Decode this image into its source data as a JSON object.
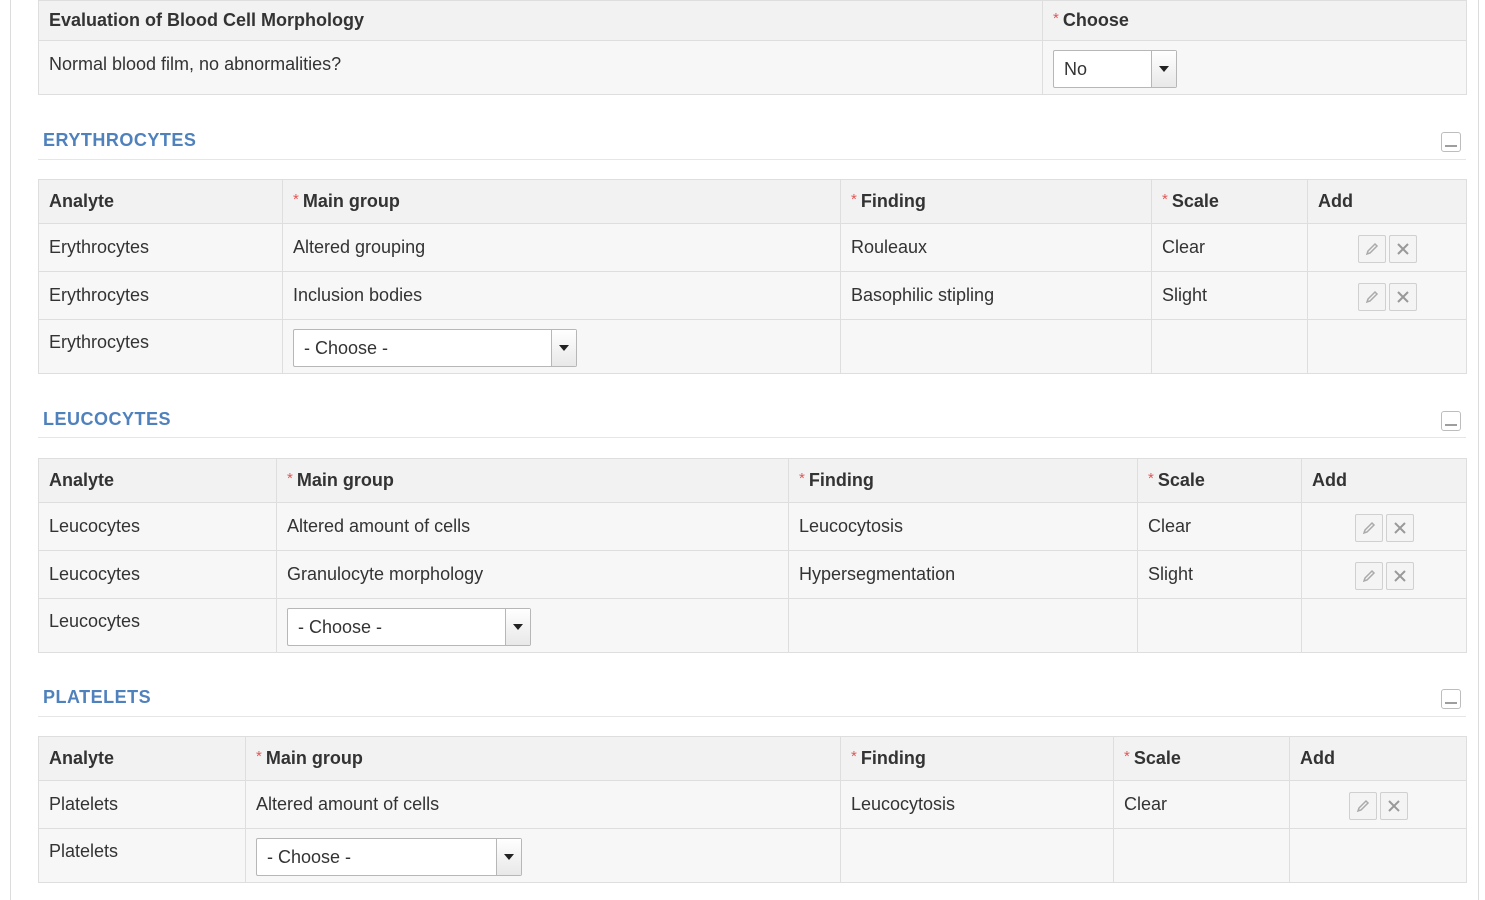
{
  "evaluation": {
    "headers": {
      "title": "Evaluation of Blood Cell Morphology",
      "choose": "Choose"
    },
    "question": "Normal blood film, no abnormalities?",
    "selected": "No"
  },
  "sections": {
    "erythrocytes": {
      "title": "ERYTHROCYTES",
      "headers": {
        "analyte": "Analyte",
        "main_group": "Main group",
        "finding": "Finding",
        "scale": "Scale",
        "add": "Add"
      },
      "rows": [
        {
          "analyte": "Erythrocytes",
          "main_group": "Altered grouping",
          "finding": "Rouleaux",
          "scale": "Clear"
        },
        {
          "analyte": "Erythrocytes",
          "main_group": "Inclusion bodies",
          "finding": "Basophilic stipling",
          "scale": "Slight"
        }
      ],
      "new_row": {
        "analyte": "Erythrocytes",
        "select": "- Choose -"
      }
    },
    "leucocytes": {
      "title": "LEUCOCYTES",
      "headers": {
        "analyte": "Analyte",
        "main_group": "Main group",
        "finding": "Finding",
        "scale": "Scale",
        "add": "Add"
      },
      "rows": [
        {
          "analyte": "Leucocytes",
          "main_group": "Altered amount of cells",
          "finding": "Leucocytosis",
          "scale": "Clear"
        },
        {
          "analyte": "Leucocytes",
          "main_group": "Granulocyte morphology",
          "finding": "Hypersegmentation",
          "scale": "Slight"
        }
      ],
      "new_row": {
        "analyte": "Leucocytes",
        "select": "- Choose -"
      }
    },
    "platelets": {
      "title": "PLATELETS",
      "headers": {
        "analyte": "Analyte",
        "main_group": "Main group",
        "finding": "Finding",
        "scale": "Scale",
        "add": "Add"
      },
      "rows": [
        {
          "analyte": "Platelets",
          "main_group": "Altered amount of cells",
          "finding": "Leucocytosis",
          "scale": "Clear"
        }
      ],
      "new_row": {
        "analyte": "Platelets",
        "select": "- Choose -"
      }
    }
  },
  "colors": {
    "section_title": "#4f81bd",
    "required_marker": "#e05757"
  },
  "icons": {
    "edit": "pencil-icon",
    "delete": "close-icon",
    "collapse": "minimize-icon"
  },
  "required_marker": "*"
}
